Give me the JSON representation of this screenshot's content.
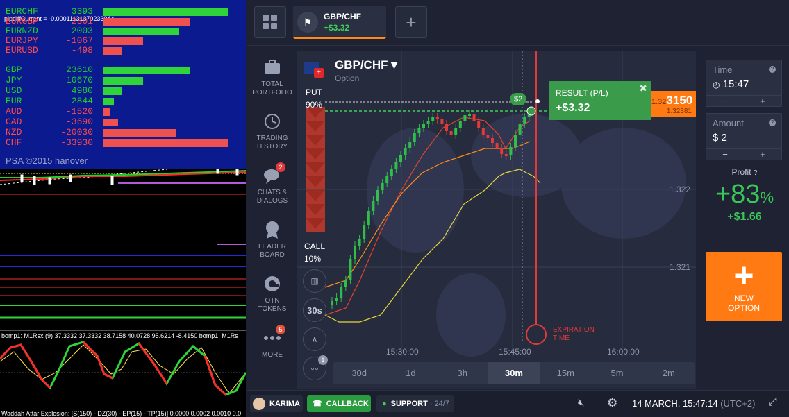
{
  "left_terminal": {
    "pipdiff_text": "pipdiffCurrent = -0.00011131370233944",
    "pairs": [
      {
        "name": "EURCHF",
        "value": "3393",
        "sign": "pos",
        "bar": 180
      },
      {
        "name": "EURGBP",
        "value": "2301",
        "sign": "neg",
        "bar": 126
      },
      {
        "name": "EURNZD",
        "value": "2003",
        "sign": "pos",
        "bar": 110
      },
      {
        "name": "EURJPY",
        "value": "-1067",
        "sign": "neg",
        "bar": 58
      },
      {
        "name": "EURUSD",
        "value": "-498",
        "sign": "neg",
        "bar": 28
      }
    ],
    "currencies": [
      {
        "name": "GBP",
        "value": "23610",
        "sign": "pos",
        "bar": 126
      },
      {
        "name": "JPY",
        "value": "10670",
        "sign": "pos",
        "bar": 58
      },
      {
        "name": "USD",
        "value": "4980",
        "sign": "pos",
        "bar": 28
      },
      {
        "name": "EUR",
        "value": "2844",
        "sign": "pos",
        "bar": 16
      },
      {
        "name": "AUD",
        "value": "-1520",
        "sign": "neg",
        "bar": 10
      },
      {
        "name": "CAD",
        "value": "-3690",
        "sign": "neg",
        "bar": 22
      },
      {
        "name": "NZD",
        "value": "-20030",
        "sign": "neg",
        "bar": 106
      },
      {
        "name": "CHF",
        "value": "-33930",
        "sign": "neg",
        "bar": 180
      }
    ],
    "copyright": "PSA ©2015 hanover",
    "osc_label": "bomp1: M1Rsx (9) 37.3332 37.3332 38.7158 40.0728 95.6214 -8.4150 bomp1: M1Rs",
    "waddah_label": "Waddah Attar Explosion: [S(150) - DZ(30) - EP(15) - TP(15)] 0.0000 0.0002 0.0010 0.0"
  },
  "topbar": {
    "asset_tab_name": "GBP/CHF",
    "asset_tab_profit": "+$3.32",
    "add_label": "+"
  },
  "sidebar": {
    "items": [
      {
        "label1": "TOTAL",
        "label2": "PORTFOLIO"
      },
      {
        "label1": "TRADING",
        "label2": "HISTORY"
      },
      {
        "label1": "CHATS &",
        "label2": "DIALOGS",
        "badge": "2"
      },
      {
        "label1": "LEADER",
        "label2": "BOARD"
      },
      {
        "label1": "OTN",
        "label2": "TOKENS"
      },
      {
        "label1": "MORE",
        "label2": "",
        "badge": "5"
      }
    ]
  },
  "chart": {
    "asset": "GBP/CHF",
    "asset_type": "Option",
    "put_label": "PUT",
    "put_pct": "90%",
    "call_label": "CALL",
    "call_pct": "10%",
    "timer_label": "30s",
    "tool_badge": "1",
    "price_levels": [
      "1.322",
      "1.321"
    ],
    "time_labels": [
      "15:30:00",
      "15:45:00",
      "16:00:00"
    ],
    "expiration_label1": "EXPIRATION",
    "expiration_label2": "TIME",
    "bet_marker": "$2",
    "current_price_tag": "3150",
    "current_price_prefix": "1.32",
    "price_below": "1.32381",
    "timeframes": [
      "30d",
      "1d",
      "3h",
      "30m",
      "15m",
      "5m",
      "2m"
    ],
    "active_timeframe": "30m"
  },
  "result_popup": {
    "title": "RESULT (P/L)",
    "value": "+$3.32"
  },
  "right_panel": {
    "time_label": "Time",
    "time_value": "15:47",
    "amount_label": "Amount",
    "amount_value": "$ 2",
    "minus": "−",
    "plus": "+",
    "profit_label": "Profit",
    "profit_pct": "+83",
    "profit_pct_unit": "%",
    "profit_amount": "+$1.66",
    "new_option_line1": "NEW",
    "new_option_line2": "OPTION"
  },
  "bottombar": {
    "user_name": "KARIMA",
    "callback_label": "CALLBACK",
    "support_label": "SUPPORT",
    "support_hours": "· 24/7",
    "datetime": "14 MARCH, 15:47:14",
    "timezone": "(UTC+2)"
  },
  "colors": {
    "accent_orange": "#ff7a12",
    "profit_green": "#39c858",
    "loss_red": "#ef5151"
  }
}
